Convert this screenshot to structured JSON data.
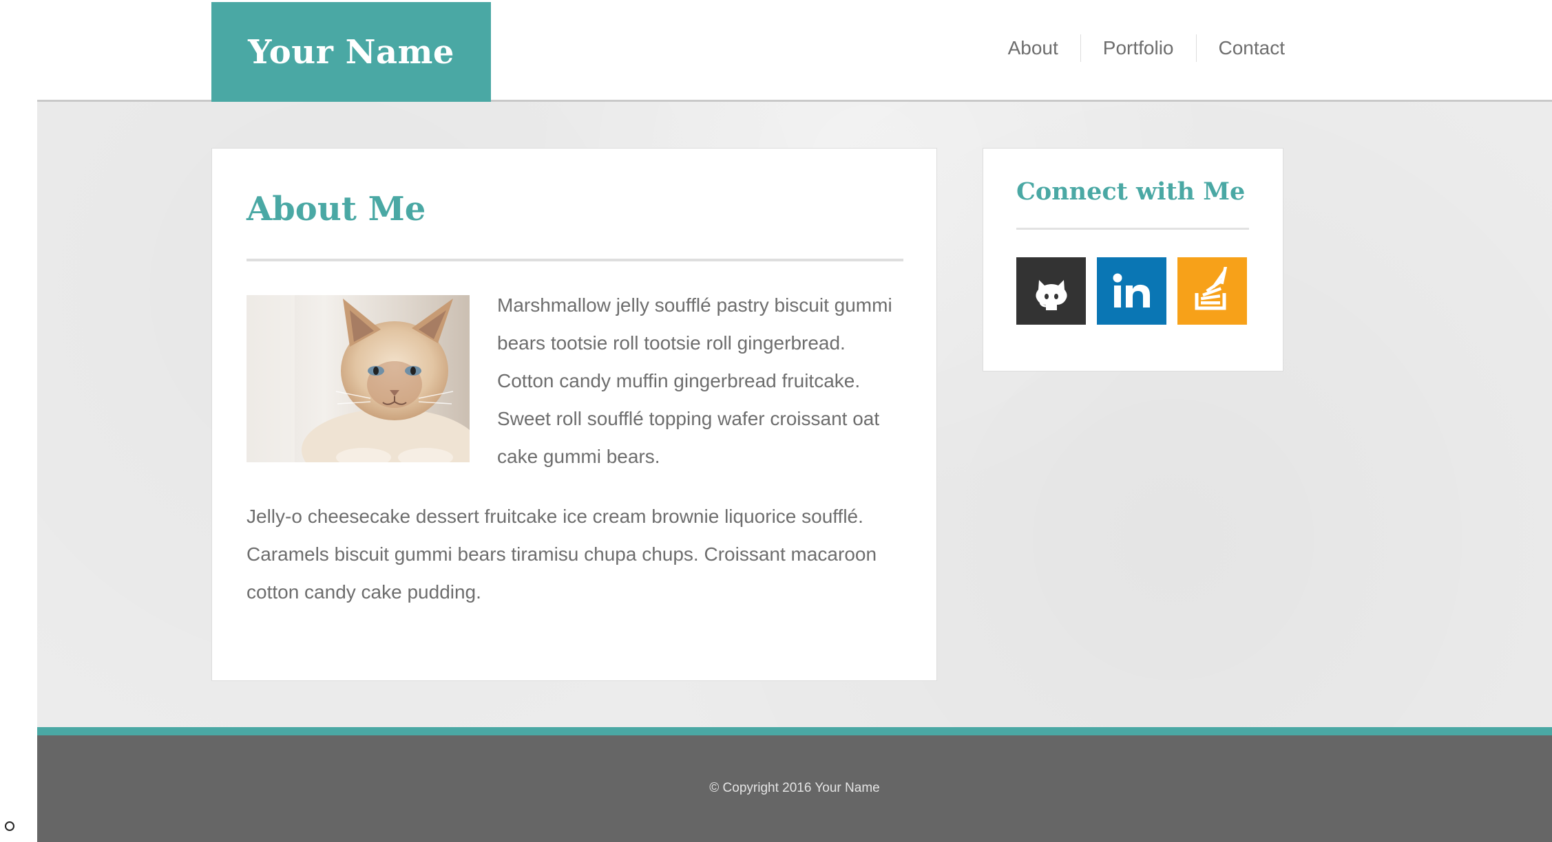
{
  "header": {
    "brand": "Your Name",
    "nav": [
      {
        "label": "About"
      },
      {
        "label": "Portfolio"
      },
      {
        "label": "Contact"
      }
    ]
  },
  "about": {
    "title": "About Me",
    "paragraphs": [
      "Marshmallow jelly soufflé pastry biscuit gummi bears tootsie roll tootsie roll gingerbread. Cotton candy muffin gingerbread fruitcake. Sweet roll soufflé topping wafer croissant oat cake gummi bears.",
      "Jelly-o cheesecake dessert fruitcake ice cream brownie liquorice soufflé. Caramels biscuit gummi bears tiramisu chupa chups. Croissant macaroon cotton candy cake pudding."
    ],
    "photo_icon": "cat-photo"
  },
  "connect": {
    "title": "Connect with Me",
    "links": [
      {
        "icon": "github-icon",
        "color": "#333333"
      },
      {
        "icon": "linkedin-icon",
        "color": "#0a76b4"
      },
      {
        "icon": "stackoverflow-icon",
        "color": "#f7a119"
      }
    ]
  },
  "footer": {
    "copyright": "© Copyright 2016 Your Name"
  },
  "colors": {
    "accent": "#4aa8a4",
    "footer": "#666666",
    "text": "#6d6d6d"
  }
}
